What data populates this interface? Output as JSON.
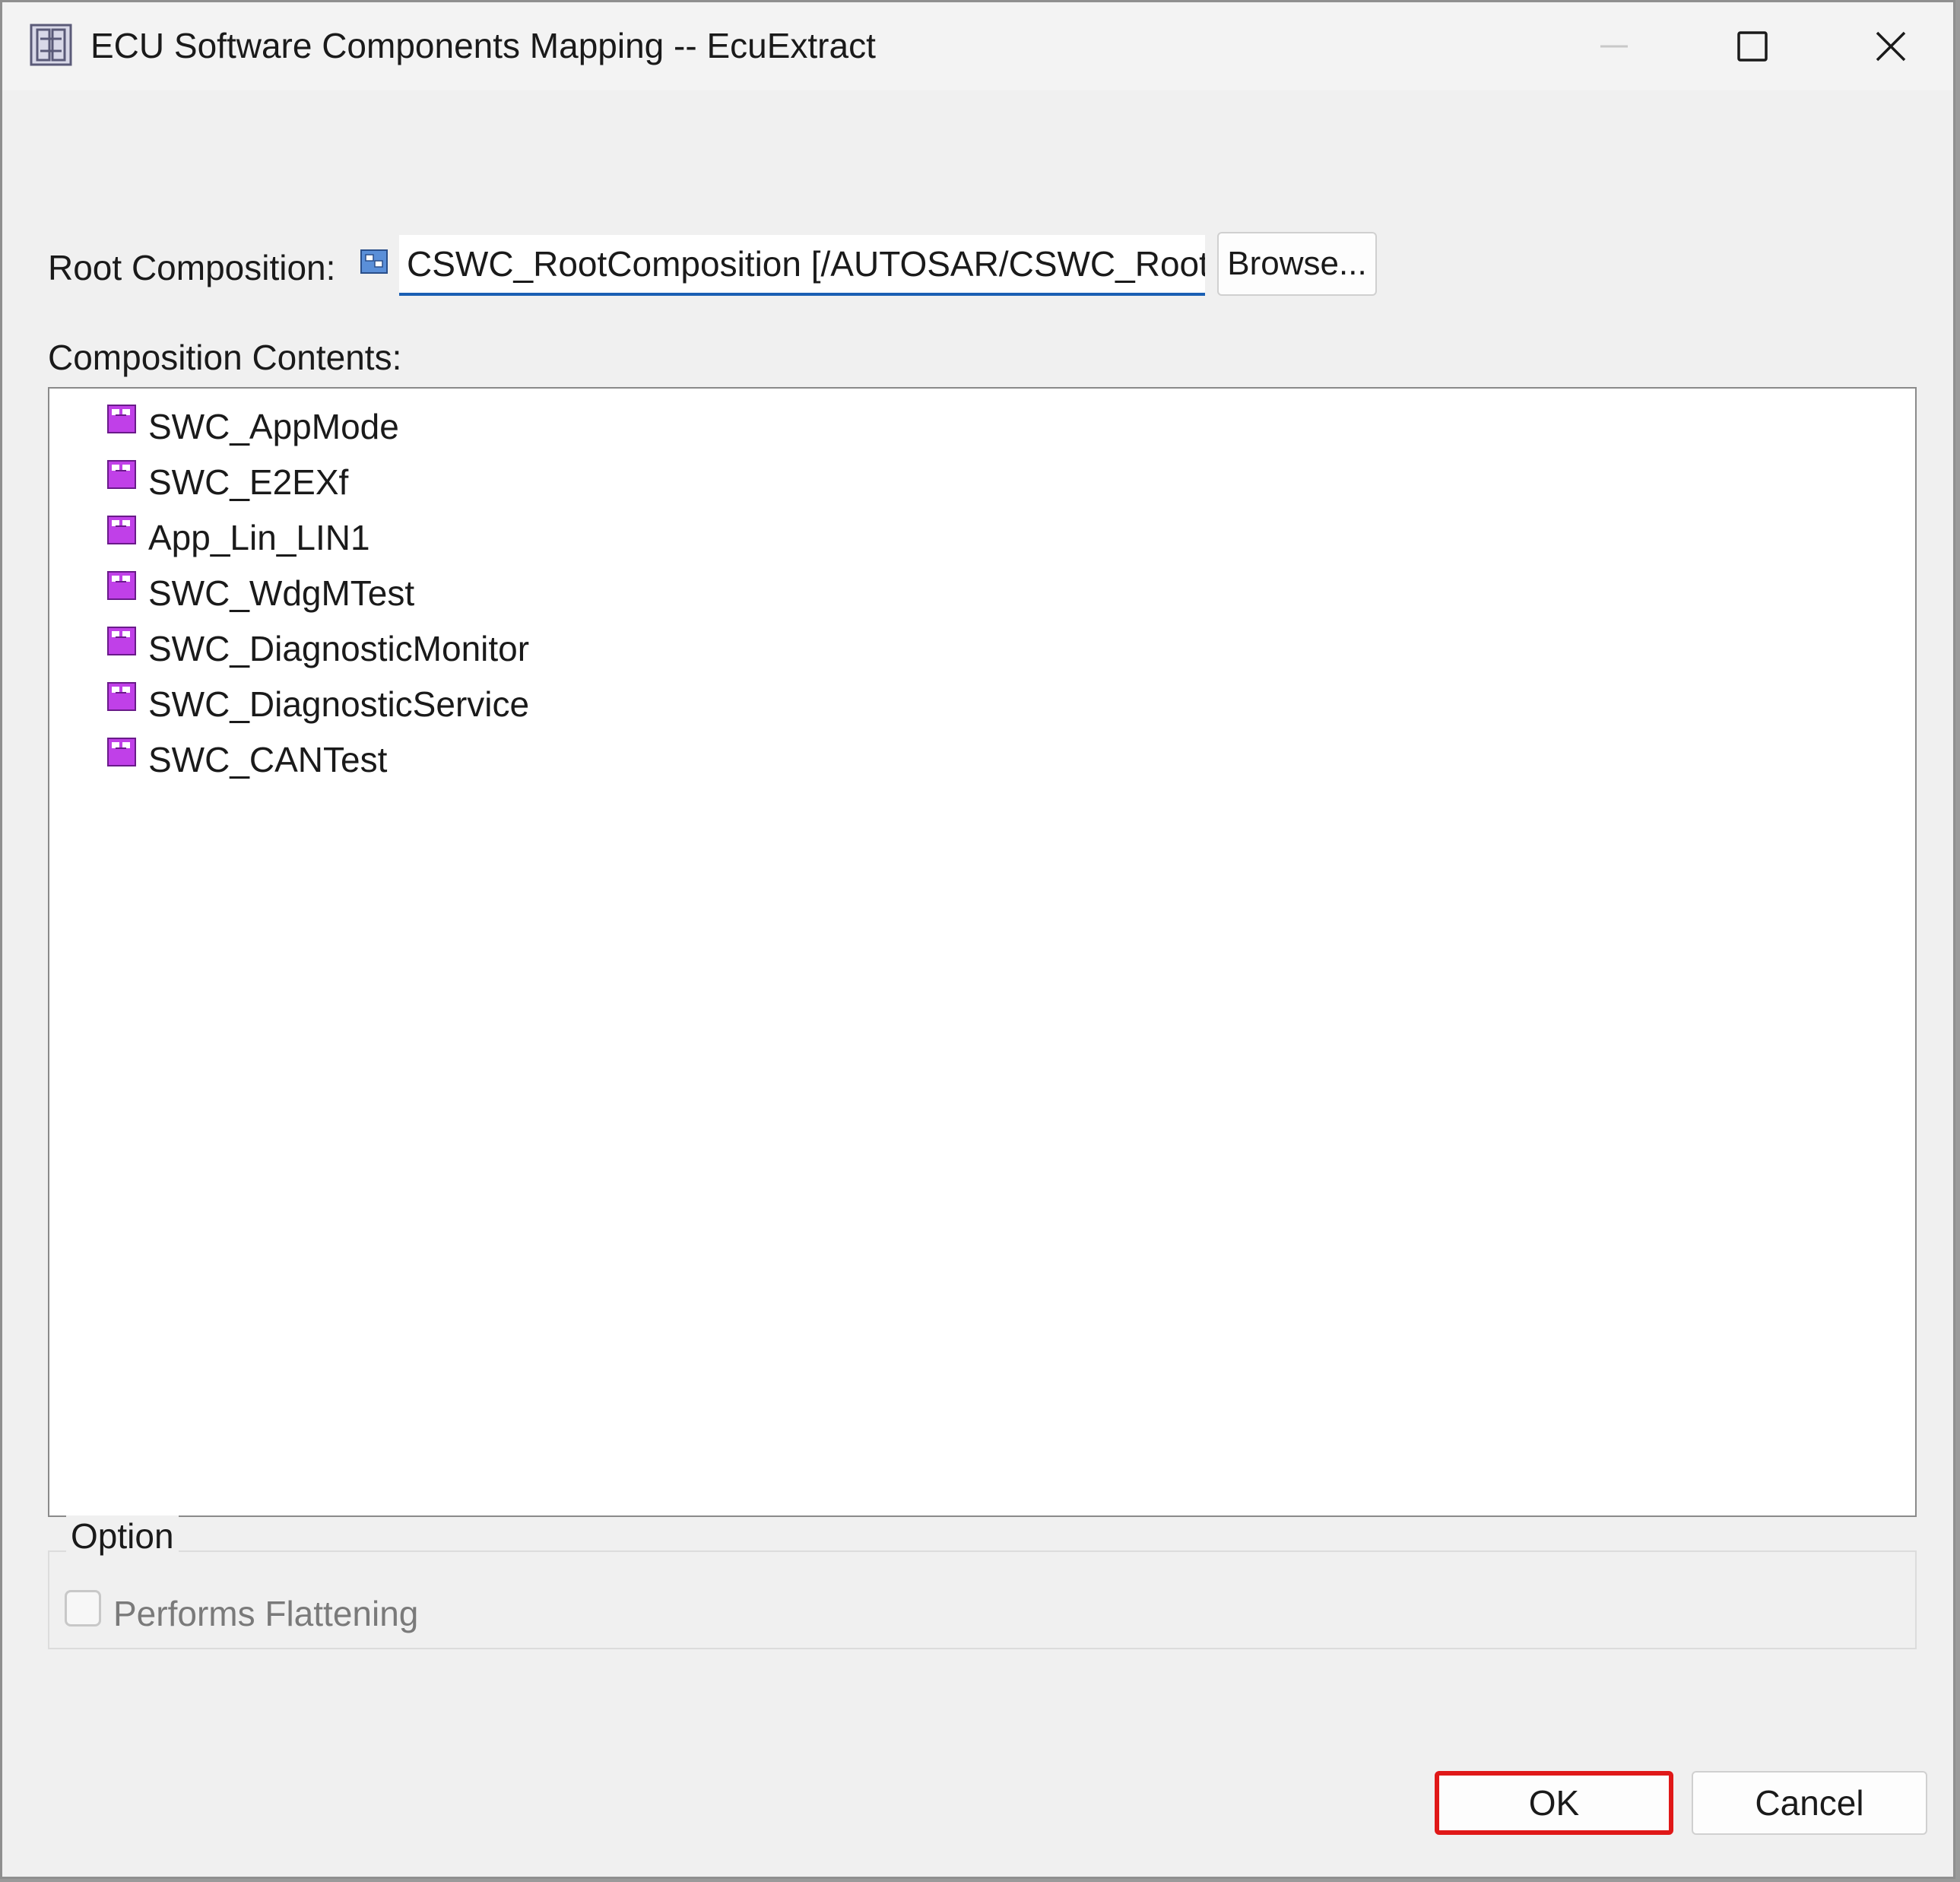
{
  "window": {
    "title": "ECU Software Components Mapping -- EcuExtract",
    "icon": "ecu-extract-icon"
  },
  "root_composition": {
    "label": "Root Composition:",
    "value": "CSWC_RootComposition [/AUTOSAR/CSWC_Root",
    "icon": "composition-icon",
    "browse_label": "Browse..."
  },
  "composition_contents": {
    "label": "Composition Contents:",
    "items": [
      {
        "label": "SWC_AppMode",
        "icon": "software-component-icon"
      },
      {
        "label": "SWC_E2EXf",
        "icon": "software-component-icon"
      },
      {
        "label": "App_Lin_LIN1",
        "icon": "software-component-icon"
      },
      {
        "label": "SWC_WdgMTest",
        "icon": "software-component-icon"
      },
      {
        "label": "SWC_DiagnosticMonitor",
        "icon": "software-component-icon"
      },
      {
        "label": "SWC_DiagnosticService",
        "icon": "software-component-icon"
      },
      {
        "label": "SWC_CANTest",
        "icon": "software-component-icon"
      }
    ]
  },
  "option": {
    "legend": "Option",
    "performs_flattening": {
      "label": "Performs Flattening",
      "checked": false,
      "enabled": false
    }
  },
  "buttons": {
    "ok": "OK",
    "cancel": "Cancel"
  },
  "colors": {
    "highlight": "#e01818",
    "component_icon": "#c040e8",
    "composition_icon": "#5a8fd8",
    "input_underline": "#1a5fb4"
  }
}
